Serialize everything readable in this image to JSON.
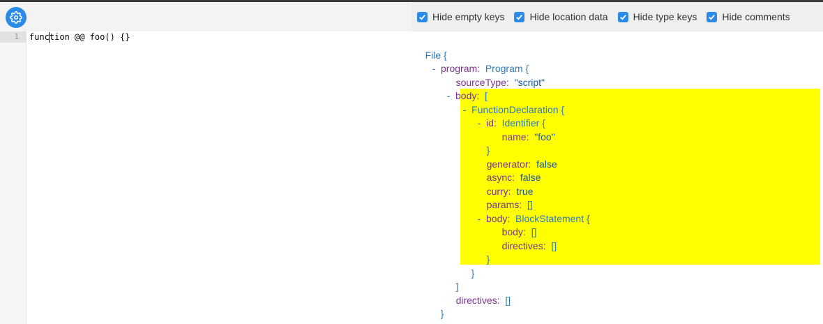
{
  "toolbar": {
    "options": [
      {
        "label": "Hide empty keys",
        "checked": true
      },
      {
        "label": "Hide location data",
        "checked": true
      },
      {
        "label": "Hide type keys",
        "checked": true
      },
      {
        "label": "Hide comments",
        "checked": true
      }
    ]
  },
  "editor": {
    "line_number": "1",
    "code": "function @@ foo() {}"
  },
  "tree": {
    "file": "File",
    "open_brace": "{",
    "close_brace": "}",
    "open_bracket": "[",
    "close_bracket": "]",
    "empty_array": "[]",
    "dash": "-",
    "program_key": "program:",
    "program_type": "Program",
    "sourceType_key": "sourceType:",
    "sourceType_val": "\"script\"",
    "body_key": "body:",
    "func_type": "FunctionDeclaration",
    "id_key": "id:",
    "id_type": "Identifier",
    "name_key": "name:",
    "name_val": "\"foo\"",
    "generator_key": "generator:",
    "generator_val": "false",
    "async_key": "async:",
    "async_val": "false",
    "curry_key": "curry:",
    "curry_val": "true",
    "params_key": "params:",
    "block_type": "BlockStatement",
    "directives_key": "directives:"
  },
  "colors": {
    "accent": "#2b8ae6",
    "highlight": "#ffff00",
    "key": "#7b3294",
    "type": "#2b7bbd"
  },
  "icons": {
    "settings": "gear-icon",
    "checkbox": "check-icon"
  }
}
